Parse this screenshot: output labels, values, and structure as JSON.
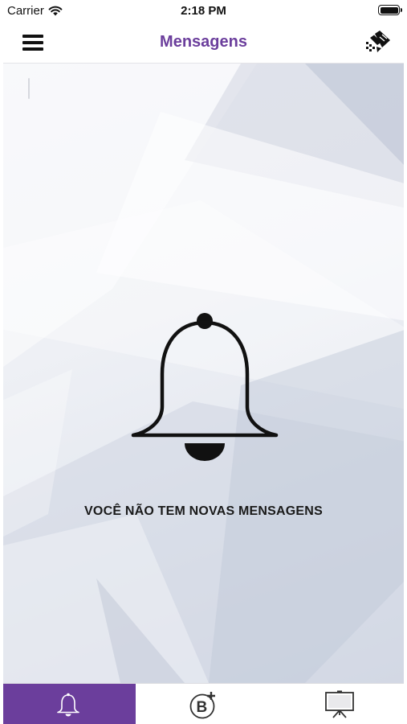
{
  "status_bar": {
    "carrier": "Carrier",
    "time": "2:18 PM"
  },
  "nav": {
    "title": "Mensagens",
    "menu_icon": "hamburger-menu-icon",
    "logo_icon": "brand-logo-icon"
  },
  "content": {
    "icon": "bell-icon",
    "empty_message": "VOCÊ NÃO TEM NOVAS MENSAGENS"
  },
  "tabs": [
    {
      "icon": "bell-icon",
      "active": true
    },
    {
      "icon": "b-plus-icon",
      "active": false
    },
    {
      "icon": "presentation-board-icon",
      "active": false
    }
  ],
  "colors": {
    "accent": "#6b3e9c",
    "text": "#1a1a1a"
  }
}
